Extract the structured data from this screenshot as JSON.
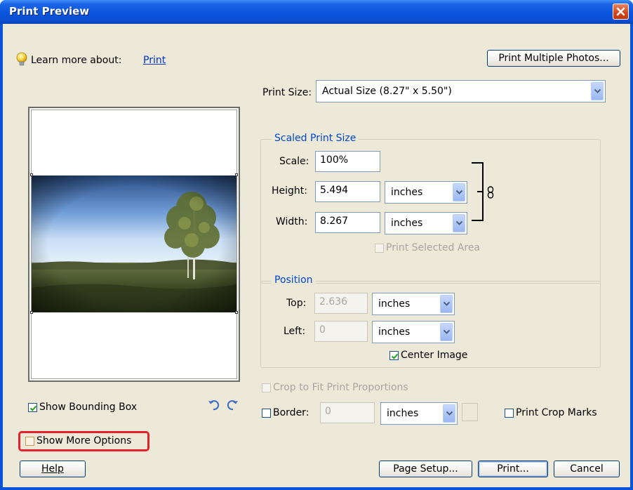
{
  "window": {
    "title": "Print Preview"
  },
  "help_line": {
    "prefix": "Learn more about:",
    "link": "Print"
  },
  "buttons": {
    "print_multiple": "Print Multiple Photos...",
    "help": "Help",
    "page_setup": "Page Setup...",
    "print": "Print...",
    "cancel": "Cancel"
  },
  "print_size": {
    "label": "Print Size:",
    "value": "Actual Size (8.27\" x 5.50\")"
  },
  "scaled_print_size": {
    "legend": "Scaled Print Size",
    "scale_label": "Scale:",
    "scale_value": "100%",
    "height_label": "Height:",
    "height_value": "5.494",
    "height_unit": "inches",
    "width_label": "Width:",
    "width_value": "8.267",
    "width_unit": "inches",
    "print_selected_area": "Print Selected Area"
  },
  "position": {
    "legend": "Position",
    "top_label": "Top:",
    "top_value": "2.636",
    "top_unit": "inches",
    "left_label": "Left:",
    "left_value": "0",
    "left_unit": "inches",
    "center_image": "Center Image"
  },
  "crop_to_fit": "Crop to Fit Print Proportions",
  "border": {
    "label": "Border:",
    "value": "0",
    "unit": "inches"
  },
  "print_crop_marks": "Print Crop Marks",
  "show_bounding_box": "Show Bounding Box",
  "show_more_options": "Show More Options",
  "checked": {
    "show_bounding_box": true,
    "center_image": true,
    "show_more_options": false,
    "border": false,
    "print_crop_marks": false,
    "crop_to_fit": false,
    "print_selected_area": false
  },
  "colors": {
    "title_bar": "#0a53d6",
    "dialog_bg": "#ece9d8",
    "group_legend": "#0046d5",
    "highlight": "#e4222d"
  }
}
